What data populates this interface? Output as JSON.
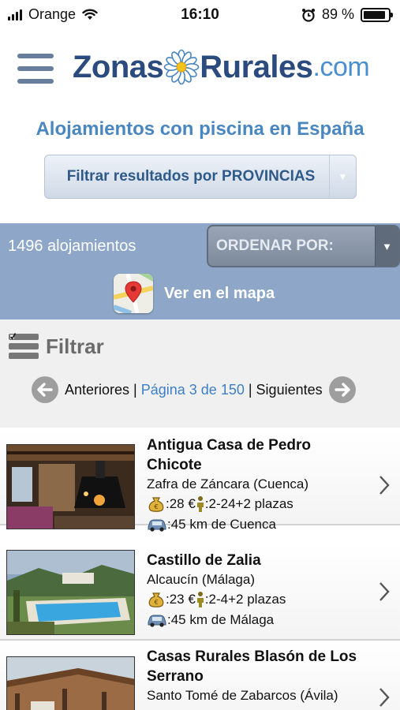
{
  "status": {
    "carrier": "Orange",
    "time": "16:10",
    "battery": "89 %",
    "battery_level": 0.89
  },
  "header": {
    "brand_left": "Zonas",
    "brand_right": "Rurales",
    "brand_suffix": ".com"
  },
  "subtitle": "Alojamientos con piscina en España",
  "province_filter": {
    "label": "Filtrar resultados por PROVINCIAS"
  },
  "results": {
    "count": "1496 alojamientos",
    "sort_label": "ORDENAR POR:",
    "map_label": "Ver en el mapa"
  },
  "filter": {
    "label": "Filtrar",
    "prev": "Anteriores",
    "page": "Página 3 de 150",
    "next": "Siguientes",
    "separator": "|"
  },
  "listings": [
    {
      "title": "Antigua Casa de Pedro Chicote",
      "location": "Zafra de Záncara (Cuenca)",
      "price": ":28 €",
      "capacity": ":2-24+2 plazas",
      "distance": ":45 km de Cuenca"
    },
    {
      "title": "Castillo de Zalia",
      "location": "Alcaucín (Málaga)",
      "price": ":23 €",
      "capacity": ":2-4+2 plazas",
      "distance": ":45 km de Málaga"
    },
    {
      "title": "Casas Rurales Blasón de Los Serrano",
      "location": "Santo Tomé de Zabarcos (Ávila)",
      "price": "",
      "capacity": "",
      "distance": ""
    }
  ],
  "colors": {
    "brand_dark": "#2b4a7e",
    "brand_light": "#4a86c0",
    "bar": "#8ea7c8"
  }
}
